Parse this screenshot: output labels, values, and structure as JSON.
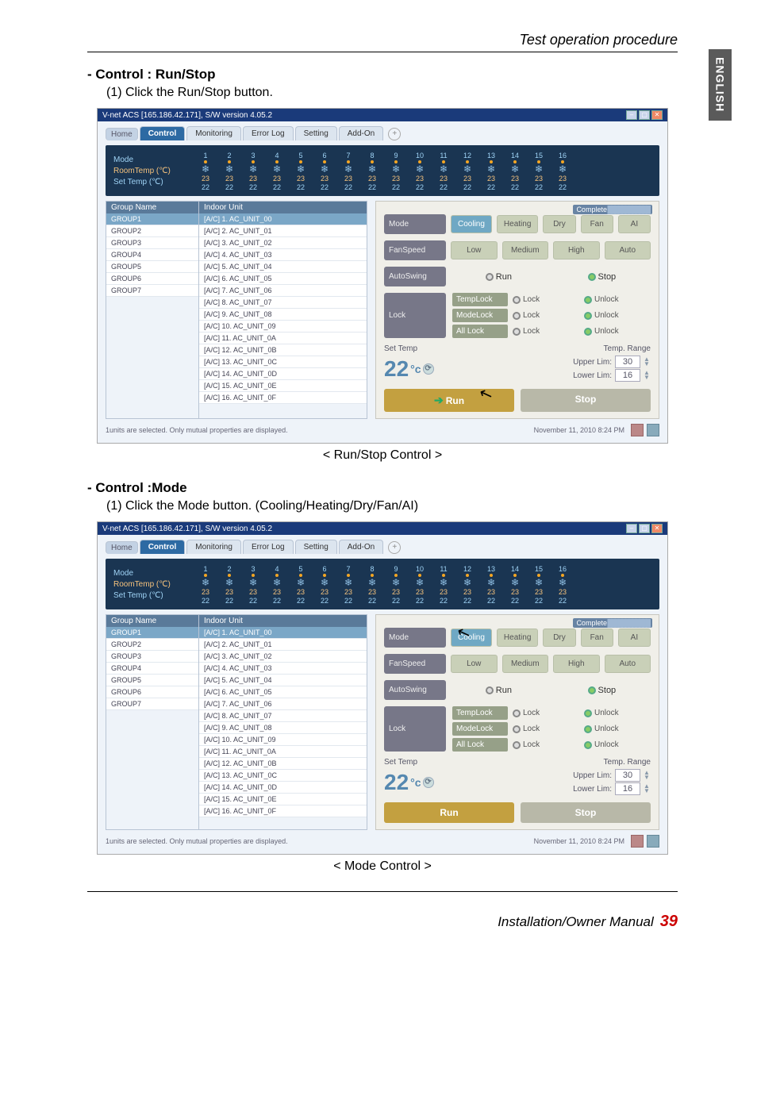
{
  "header": {
    "section_title": "Test operation procedure"
  },
  "side_tab": "ENGLISH",
  "sections": [
    {
      "title": "- Control : Run/Stop",
      "sub": "(1) Click the Run/Stop button.",
      "caption": "< Run/Stop Control >"
    },
    {
      "title": "- Control :Mode",
      "sub": "(1) Click the Mode button. (Cooling/Heating/Dry/Fan/AI)",
      "caption": "< Mode Control >"
    }
  ],
  "screenshot": {
    "window_title": "V-net ACS [165.186.42.171],   S/W version 4.05.2",
    "tabs": {
      "home": "Home",
      "items": [
        "Control",
        "Monitoring",
        "Error Log",
        "Setting",
        "Add-On"
      ],
      "active_index": 0
    },
    "thumb_block": {
      "labels": {
        "mode": "Mode",
        "room": "RoomTemp (℃)",
        "set": "Set Temp   (℃)"
      },
      "indices": [
        "1",
        "2",
        "3",
        "4",
        "5",
        "6",
        "7",
        "8",
        "9",
        "10",
        "11",
        "12",
        "13",
        "14",
        "15",
        "16"
      ],
      "room_val": "23",
      "set_val": "22"
    },
    "group_list": {
      "header": "Group Name",
      "rows": [
        "GROUP1",
        "GROUP2",
        "GROUP3",
        "GROUP4",
        "GROUP5",
        "GROUP6",
        "GROUP7"
      ],
      "selected": 0
    },
    "unit_list": {
      "header": "Indoor Unit",
      "rows": [
        "[A/C] 1. AC_UNIT_00",
        "[A/C] 2. AC_UNIT_01",
        "[A/C] 3. AC_UNIT_02",
        "[A/C] 4. AC_UNIT_03",
        "[A/C] 5. AC_UNIT_04",
        "[A/C] 6. AC_UNIT_05",
        "[A/C] 7. AC_UNIT_06",
        "[A/C] 8. AC_UNIT_07",
        "[A/C] 9. AC_UNIT_08",
        "[A/C] 10. AC_UNIT_09",
        "[A/C] 11. AC_UNIT_0A",
        "[A/C] 12. AC_UNIT_0B",
        "[A/C] 13. AC_UNIT_0C",
        "[A/C] 14. AC_UNIT_0D",
        "[A/C] 15. AC_UNIT_0E",
        "[A/C] 16. AC_UNIT_0F"
      ],
      "selected": 0
    },
    "panel": {
      "complete": "Complete",
      "mode": {
        "label": "Mode",
        "opts": [
          "Cooling",
          "Heating",
          "Dry",
          "Fan",
          "AI"
        ]
      },
      "fan": {
        "label": "FanSpeed",
        "opts": [
          "Low",
          "Medium",
          "High",
          "Auto"
        ]
      },
      "autoswing": {
        "label": "AutoSwing",
        "run": "Run",
        "stop": "Stop"
      },
      "lock": {
        "label": "Lock",
        "rows": [
          {
            "name": "TempLock",
            "a": "Lock",
            "b": "Unlock"
          },
          {
            "name": "ModeLock",
            "a": "Lock",
            "b": "Unlock"
          },
          {
            "name": "All Lock",
            "a": "Lock",
            "b": "Unlock"
          }
        ]
      },
      "set_temp": {
        "left": "Set Temp",
        "right": "Temp. Range",
        "value": "22",
        "unit": "°c",
        "upper": {
          "label": "Upper Lim:",
          "val": "30"
        },
        "lower": {
          "label": "Lower Lim:",
          "val": "16"
        }
      },
      "run": "Run",
      "stop": "Stop"
    },
    "footer": {
      "status": "1units are selected. Only mutual properties are displayed.",
      "timestamp": "November 11, 2010  8:24 PM"
    }
  },
  "page_footer": {
    "manual": "Installation/Owner Manual",
    "page": "39"
  }
}
